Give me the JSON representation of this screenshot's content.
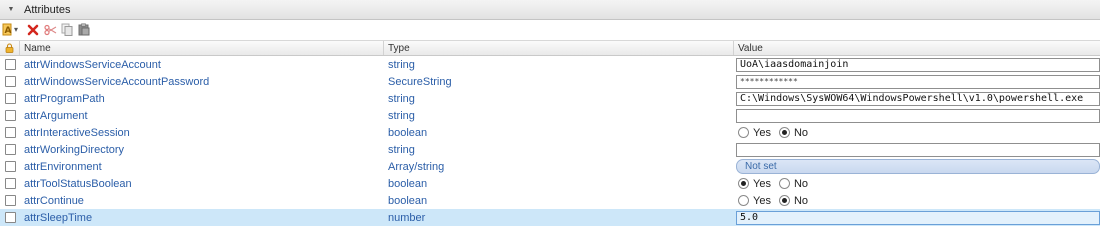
{
  "section": {
    "title": "Attributes",
    "expanded": true
  },
  "toolbar": {
    "buttons": [
      {
        "name": "add-attribute-button",
        "icon": "add-attribute-icon"
      },
      {
        "name": "delete-button",
        "icon": "red-x-icon"
      },
      {
        "name": "cut-button",
        "icon": "scissors-icon"
      },
      {
        "name": "copy-button",
        "icon": "copy-icon"
      },
      {
        "name": "paste-button",
        "icon": "paste-icon"
      }
    ]
  },
  "table": {
    "columns": {
      "lock": "lock-icon",
      "name": "Name",
      "type": "Type",
      "value": "Value"
    },
    "rows": [
      {
        "name": "attrWindowsServiceAccount",
        "type": "string",
        "value_kind": "text",
        "value": "UoA\\iaasdomainjoin"
      },
      {
        "name": "attrWindowsServiceAccountPassword",
        "type": "SecureString",
        "value_kind": "password",
        "value": "************"
      },
      {
        "name": "attrProgramPath",
        "type": "string",
        "value_kind": "text",
        "value": "C:\\Windows\\SysWOW64\\WindowsPowershell\\v1.0\\powershell.exe"
      },
      {
        "name": "attrArgument",
        "type": "string",
        "value_kind": "text",
        "value": ""
      },
      {
        "name": "attrInteractiveSession",
        "type": "boolean",
        "value_kind": "bool",
        "yes_label": "Yes",
        "no_label": "No",
        "value": false
      },
      {
        "name": "attrWorkingDirectory",
        "type": "string",
        "value_kind": "text",
        "value": ""
      },
      {
        "name": "attrEnvironment",
        "type": "Array/string",
        "value_kind": "notset",
        "value": "Not set"
      },
      {
        "name": "attrToolStatusBoolean",
        "type": "boolean",
        "value_kind": "bool",
        "yes_label": "Yes",
        "no_label": "No",
        "value": true
      },
      {
        "name": "attrContinue",
        "type": "boolean",
        "value_kind": "bool",
        "yes_label": "Yes",
        "no_label": "No",
        "value": false
      },
      {
        "name": "attrSleepTime",
        "type": "number",
        "value_kind": "text",
        "value": "5.0",
        "selected": true
      }
    ]
  },
  "colors": {
    "link_text": "#2b5ea8",
    "selected_row": "#cde7f9",
    "pill_bg": "#d3e0f3"
  }
}
